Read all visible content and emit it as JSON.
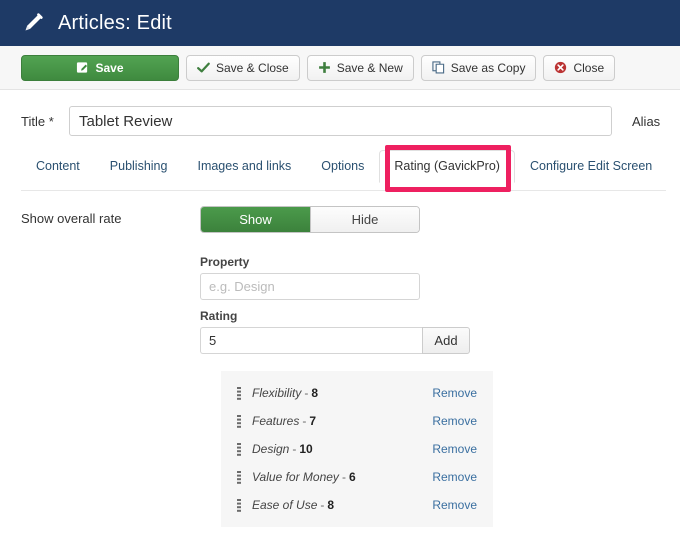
{
  "header": {
    "title": "Articles: Edit",
    "icon": "pencil-icon",
    "bg_color": "#1e3a66"
  },
  "toolbar": {
    "save_label": "Save",
    "save_close_label": "Save & Close",
    "save_new_label": "Save & New",
    "save_copy_label": "Save as Copy",
    "close_label": "Close",
    "save_icon": "edit-square-icon",
    "save_close_icon": "check-icon",
    "save_new_icon": "plus-icon",
    "save_copy_icon": "copy-icon",
    "close_icon": "close-circle-icon",
    "save_color": "#3f8a3f"
  },
  "title_field": {
    "label": "Title *",
    "value": "Tablet Review",
    "placeholder": "",
    "alias_label": "Alias"
  },
  "tabs": [
    {
      "label": "Content",
      "active": false
    },
    {
      "label": "Publishing",
      "active": false
    },
    {
      "label": "Images and links",
      "active": false
    },
    {
      "label": "Options",
      "active": false
    },
    {
      "label": "Rating (GavickPro)",
      "active": true
    },
    {
      "label": "Configure Edit Screen",
      "active": false
    }
  ],
  "highlight": {
    "target_tab": "Rating (GavickPro)",
    "color": "#ee2060"
  },
  "rating_panel": {
    "show_overall_label": "Show overall rate",
    "toggle": {
      "on_label": "Show",
      "off_label": "Hide",
      "selected": "Show",
      "on_color": "#3c823c"
    },
    "property_label": "Property",
    "property_value": "",
    "property_placeholder": "e.g. Design",
    "rating_label": "Rating",
    "rating_value": "5",
    "rating_placeholder": "",
    "add_label": "Add",
    "remove_label": "Remove",
    "items": [
      {
        "name": "Flexibility",
        "separator": "-",
        "value": "8",
        "remove": "Remove"
      },
      {
        "name": "Features",
        "separator": "-",
        "value": "7",
        "remove": "Remove"
      },
      {
        "name": "Design",
        "separator": "-",
        "value": "10",
        "remove": "Remove"
      },
      {
        "name": "Value for Money",
        "separator": "-",
        "value": "6",
        "remove": "Remove"
      },
      {
        "name": "Ease of Use",
        "separator": "-",
        "value": "8",
        "remove": "Remove"
      }
    ]
  }
}
